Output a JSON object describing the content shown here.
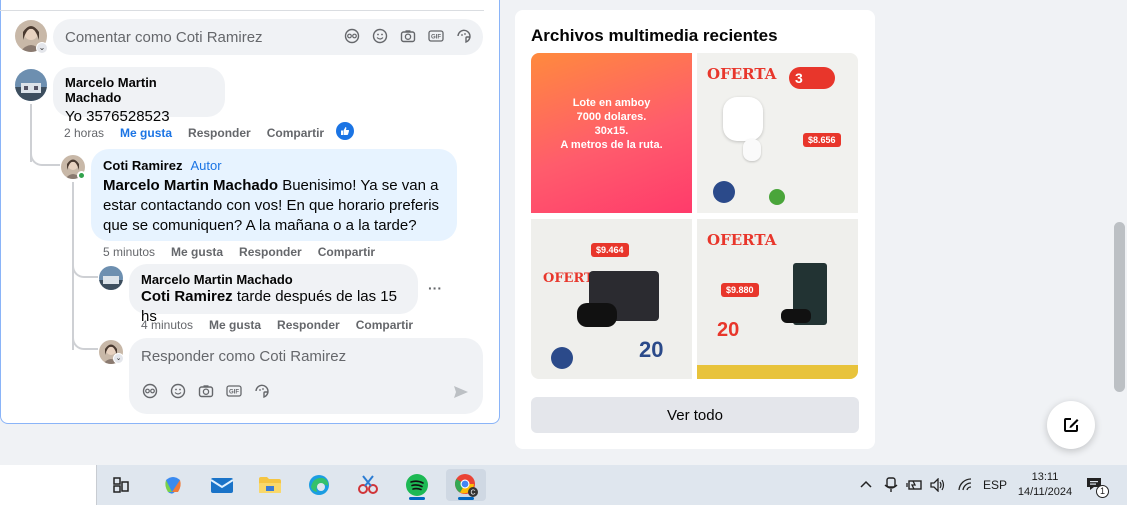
{
  "post": {
    "comment_placeholder": "Comentar como Coti Ramirez",
    "comments": [
      {
        "name": "Marcelo Martin Machado",
        "text": "Yo 3576528523",
        "time": "2 horas",
        "like": "Me gusta",
        "reply": "Responder",
        "share": "Compartir",
        "reaction_icon": "thumbs-up-icon"
      },
      {
        "name": "Coti Ramirez",
        "author_tag": "Autor",
        "mention": "Marcelo Martin Machado",
        "text_line1": " Buenisimo! Ya se van a",
        "text_line2": "estar contactando con vos! En que horario preferis",
        "text_line3": "que se comuniquen? A la mañana o a la tarde?",
        "time": "5 minutos",
        "like": "Me gusta",
        "reply": "Responder",
        "share": "Compartir"
      },
      {
        "name": "Marcelo Martin Machado",
        "mention": "Coti Ramirez",
        "text": " tarde después de las 15 hs",
        "time": "4 minutos",
        "like": "Me gusta",
        "reply": "Responder",
        "share": "Compartir",
        "more": "···"
      }
    ],
    "reply_placeholder": "Responder como Coti Ramirez"
  },
  "media": {
    "title": "Archivos multimedia recientes",
    "tile1_text": [
      "Lote en amboy",
      "7000 dolares.",
      "30x15.",
      "A metros de la ruta."
    ],
    "tile2": {
      "oferta": "OFERTA",
      "badge": "3",
      "price": "$8.656"
    },
    "tile3": {
      "oferta": "OFERTA",
      "price": "$9.464",
      "pct": "20"
    },
    "tile4": {
      "oferta": "OFERTA",
      "price": "$9.880",
      "pct": "20"
    },
    "see_all": "Ver todo"
  },
  "taskbar": {
    "lang": "ESP",
    "time": "13:11",
    "date": "14/11/2024",
    "notification_count": "1"
  },
  "colors": {
    "facebook_blue": "#1b74e4",
    "author_bubble": "#e7f3ff",
    "bubble": "#f0f2f5",
    "offer_red": "#e8362b"
  }
}
